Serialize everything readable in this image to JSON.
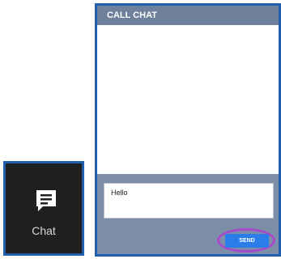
{
  "launcher": {
    "label": "Chat",
    "icon": "chat-bubble-icon"
  },
  "panel": {
    "title": "CALL CHAT",
    "message_value": "Hello",
    "send_label": "SEND",
    "highlight_color": "#a64ac9",
    "accent_color": "#2b7de9"
  }
}
